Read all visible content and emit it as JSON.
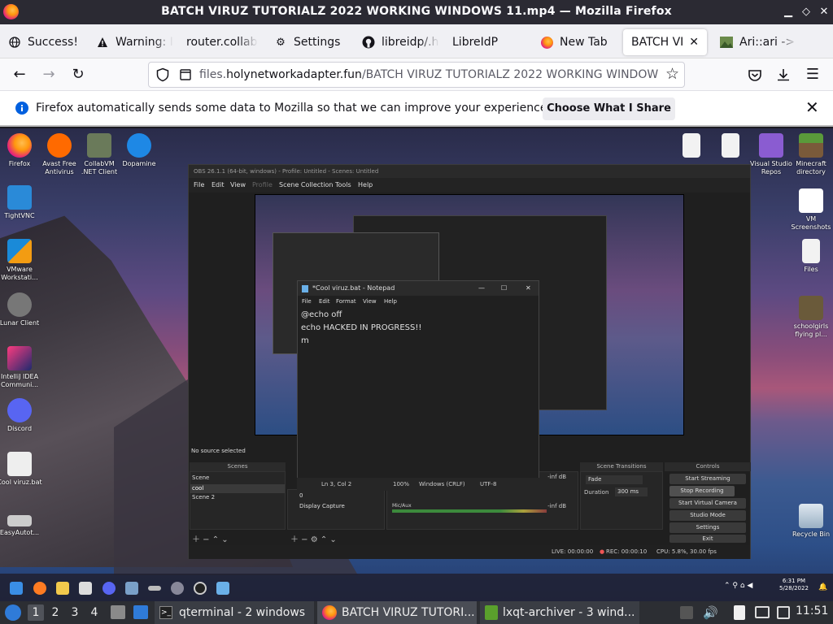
{
  "window": {
    "title": "BATCH VIRUZ TUTORIALZ 2022 WORKING WINDOWS 11.mp4 — Mozilla Firefox"
  },
  "tabs": [
    {
      "label": "Success!",
      "icon": "globe-icon"
    },
    {
      "label": "Warning: I",
      "icon": "warning-icon"
    },
    {
      "label": "router.collab",
      "icon": "none"
    },
    {
      "label": "Settings",
      "icon": "gear-icon"
    },
    {
      "label": "libreidp/.h",
      "icon": "github-icon"
    },
    {
      "label": "LibreIdP",
      "icon": "none"
    },
    {
      "label": "New Tab",
      "icon": "firefox-icon"
    },
    {
      "label": "BATCH VIRU",
      "icon": "none",
      "active": true
    },
    {
      "label": "Ari::ari ->",
      "icon": "image-icon"
    }
  ],
  "urlbar": {
    "prefix": "files.",
    "domain": "holynetworkadapter.fun",
    "path": "/BATCH VIRUZ TUTORIALZ 2022 WORKING WINDOW"
  },
  "notification": {
    "message": "Firefox automatically sends some data to Mozilla so that we can improve your experience.",
    "button": "Choose What I Share"
  },
  "desktop_icons": {
    "left": [
      "Firefox",
      "Avast Free Antivirus",
      "CollabVM .NET Client",
      "Dopamine",
      "TightVNC",
      "VMware Workstati...",
      "Lunar Client",
      "IntelliJ IDEA Communi...",
      "Discord",
      "Cool viruz.bat",
      "EasyAutot..."
    ],
    "right": [
      "Visual Studio Repos",
      "Minecraft directory",
      "VM Screenshots",
      "Files",
      "schoolgirls flying pl...",
      "Recycle Bin"
    ]
  },
  "obs": {
    "title": "OBS 26.1.1 (64-bit, windows) - Profile: Untitled - Scenes: Untitled",
    "menu": [
      "File",
      "Edit",
      "View",
      "Profile",
      "Scene Collection",
      "Tools",
      "Help"
    ],
    "status": "No source selected",
    "scenes_header": "Scenes",
    "scenes": [
      "Scene",
      "cool",
      "Scene 2"
    ],
    "sources": [
      "0",
      "Display Capture"
    ],
    "mixer": {
      "desktop_db": "-inf dB",
      "mic_label": "Mic/Aux",
      "mic_db": "-inf dB"
    },
    "transitions_header": "Scene Transitions",
    "transition": "Fade",
    "duration_label": "Duration",
    "duration": "300 ms",
    "controls_header": "Controls",
    "controls": [
      "Start Streaming",
      "Stop Recording",
      "Start Virtual Camera",
      "Studio Mode",
      "Settings",
      "Exit"
    ],
    "footer": {
      "live": "LIVE: 00:00:00",
      "rec": "REC: 00:00:10",
      "cpu": "CPU: 5.8%, 30.00 fps"
    }
  },
  "notepad": {
    "title": "*Cool viruz.bat - Notepad",
    "menu": [
      "File",
      "Edit",
      "Format",
      "View",
      "Help"
    ],
    "lines": [
      "@echo off",
      "echo HACKED IN PROGRESS!!",
      "m"
    ],
    "status": {
      "pos": "Ln 3, Col 2",
      "zoom": "100%",
      "eol": "Windows (CRLF)",
      "enc": "UTF-8"
    }
  },
  "win11_taskbar": {
    "time": "6:31 PM",
    "date": "5/28/2022"
  },
  "lxqt": {
    "workspaces": [
      "1",
      "2",
      "3",
      "4"
    ],
    "tasks": [
      "qterminal - 2 windows",
      "BATCH VIRUZ TUTORI...",
      "lxqt-archiver - 3 wind..."
    ],
    "clock": "11:51"
  }
}
